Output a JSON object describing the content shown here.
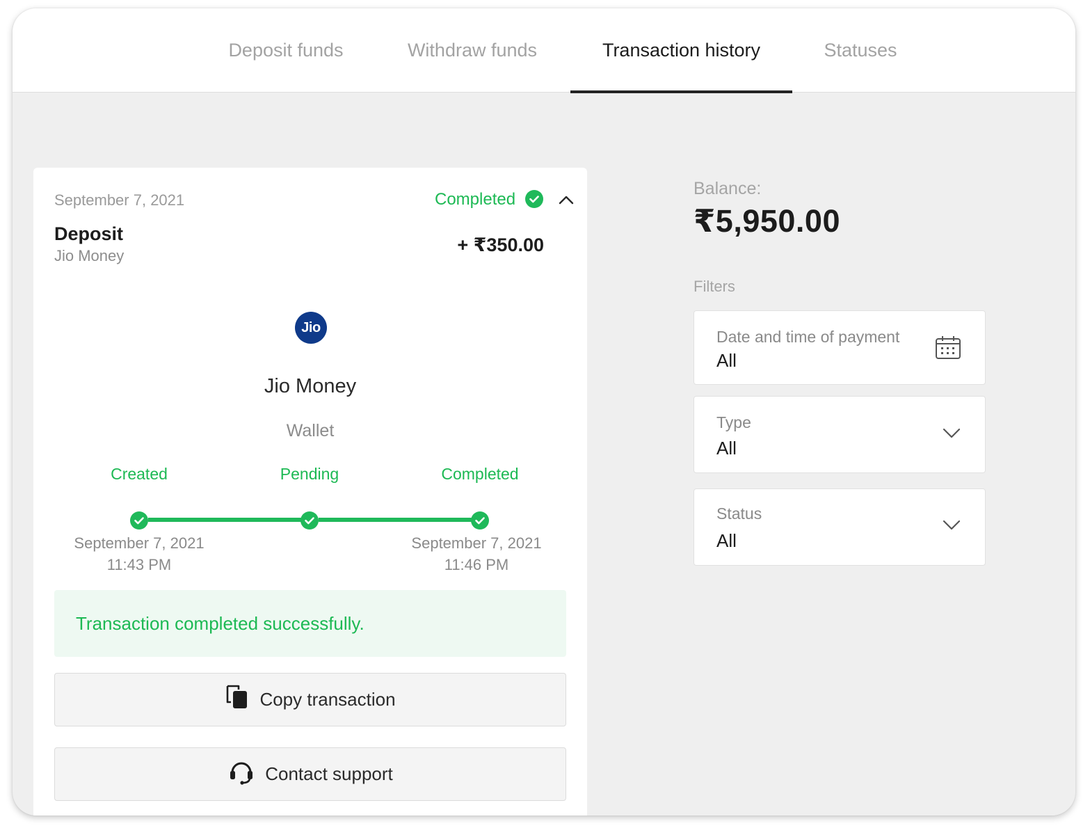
{
  "tabs": [
    {
      "label": "Deposit funds",
      "active": false
    },
    {
      "label": "Withdraw funds",
      "active": false
    },
    {
      "label": "Transaction history",
      "active": true
    },
    {
      "label": "Statuses",
      "active": false
    }
  ],
  "transaction": {
    "date": "September 7, 2021",
    "status": "Completed",
    "type": "Deposit",
    "method": "Jio Money",
    "amount": "+ ₹350.00",
    "logo_text": "Jio",
    "method_name": "Jio Money",
    "method_kind": "Wallet",
    "steps": [
      {
        "label": "Created",
        "date": "September 7, 2021",
        "time": "11:43 PM"
      },
      {
        "label": "Pending",
        "date": "",
        "time": ""
      },
      {
        "label": "Completed",
        "date": "September 7, 2021",
        "time": "11:46 PM"
      }
    ],
    "success_message": "Transaction completed successfully.",
    "copy_label": "Copy transaction",
    "support_label": "Contact support"
  },
  "balance": {
    "label": "Balance:",
    "value": "₹5,950.00"
  },
  "filters": {
    "title": "Filters",
    "date": {
      "label": "Date and time of payment",
      "value": "All"
    },
    "type": {
      "label": "Type",
      "value": "All"
    },
    "status": {
      "label": "Status",
      "value": "All"
    }
  },
  "colors": {
    "accent_green": "#1db954",
    "success_bg": "#eef9f2",
    "logo_blue": "#0f3a8a"
  },
  "icons": {
    "status_check": "check-circle-icon",
    "collapse": "chevron-up-icon",
    "calendar": "calendar-icon",
    "dropdown": "chevron-down-icon",
    "copy": "copy-icon",
    "support": "headset-icon"
  }
}
